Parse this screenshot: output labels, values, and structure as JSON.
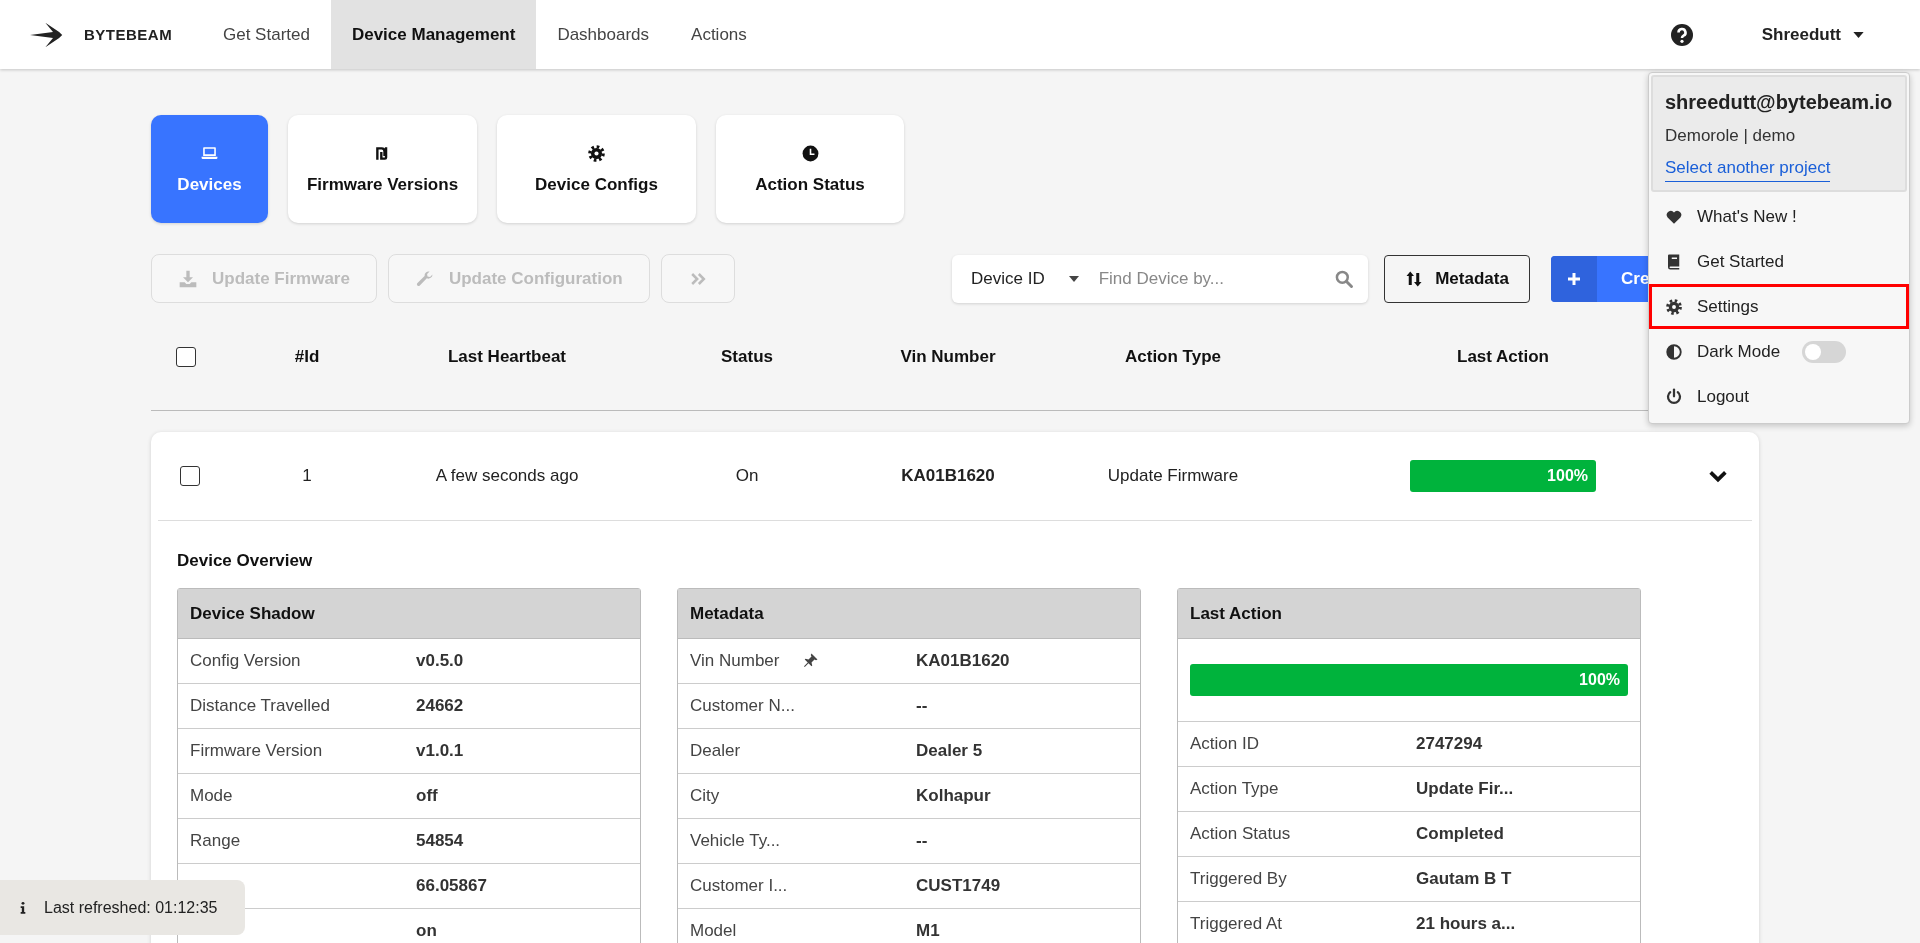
{
  "nav": {
    "brand": "BYTEBEAM",
    "items": [
      {
        "label": "Get Started",
        "selected": false
      },
      {
        "label": "Device Management",
        "selected": true
      },
      {
        "label": "Dashboards",
        "selected": false
      },
      {
        "label": "Actions",
        "selected": false
      }
    ],
    "user": "Shreedutt"
  },
  "tabs": [
    {
      "label": "Devices",
      "selected": true
    },
    {
      "label": "Firmware Versions",
      "selected": false
    },
    {
      "label": "Device Configs",
      "selected": false
    },
    {
      "label": "Action Status",
      "selected": false
    }
  ],
  "toolbar": {
    "buttons": [
      {
        "label": "Update Firmware",
        "disabled": true
      },
      {
        "label": "Update Configuration",
        "disabled": true
      },
      {
        "disabled": true
      }
    ],
    "search": {
      "field": "Device ID",
      "placeholder": "Find Device by..."
    },
    "metadata_button": "Metadata",
    "create_button": "Cre"
  },
  "table": {
    "columns": [
      "#Id",
      "Last Heartbeat",
      "Status",
      "Vin Number",
      "Action Type",
      "Last Action"
    ],
    "select_all_checked": false,
    "rows": [
      {
        "checked": false,
        "expanded": true,
        "id": "1",
        "last_heartbeat": "A few seconds ago",
        "status": "On",
        "vin_number": "KA01B1620",
        "action_type": "Update Firmware",
        "last_action": {
          "level": 1,
          "reading": "100%"
        }
      }
    ]
  },
  "overview": {
    "title": "Device Overview",
    "cards": [
      {
        "title": "Device Shadow",
        "rows": [
          {
            "label": "Config Version",
            "value": "v0.5.0"
          },
          {
            "label": "Distance Travelled",
            "value": "24662"
          },
          {
            "label": "Firmware Version",
            "value": "v1.0.1"
          },
          {
            "label": "Mode",
            "value": "off"
          },
          {
            "label": "Range",
            "value": "54854"
          },
          {
            "value": "66.05867"
          },
          {
            "value": "on"
          }
        ]
      },
      {
        "title": "Metadata",
        "rows": [
          {
            "label": "Vin Number",
            "pinned": true,
            "value": "KA01B1620"
          },
          {
            "label": "Customer N...",
            "pinned": false,
            "value": "--"
          },
          {
            "label": "Dealer",
            "pinned": false,
            "value": "Dealer 5"
          },
          {
            "label": "City",
            "pinned": false,
            "value": "Kolhapur"
          },
          {
            "label": "Vehicle Ty...",
            "pinned": false,
            "value": "--"
          },
          {
            "label": "Customer I...",
            "pinned": false,
            "value": "CUST1749"
          },
          {
            "label": "Model",
            "pinned": false,
            "value": "M1"
          }
        ]
      },
      {
        "title": "Last Action",
        "progress": {
          "level": 1,
          "reading": "100%"
        },
        "rows": [
          {
            "label": "Action ID",
            "value": "2747294"
          },
          {
            "label": "Action Type",
            "value": "Update Fir..."
          },
          {
            "label": "Action Status",
            "value": "Completed"
          },
          {
            "label": "Triggered By",
            "value": "Gautam B T"
          },
          {
            "label": "Triggered At",
            "value": "21 hours a..."
          }
        ]
      }
    ]
  },
  "user_menu": {
    "email": "shreedutt@bytebeam.io",
    "role": "Demorole | demo",
    "link": "Select another project",
    "items": [
      {
        "kind": "link",
        "label": "What's New !",
        "selected": false
      },
      {
        "kind": "link",
        "label": "Get Started",
        "selected": false
      },
      {
        "kind": "link",
        "label": "Settings",
        "selected": true
      },
      {
        "kind": "toggle",
        "label": "Dark Mode",
        "on": false
      },
      {
        "kind": "link",
        "label": "Logout",
        "selected": false
      }
    ]
  },
  "toast": "Last refreshed: 01:12:35"
}
